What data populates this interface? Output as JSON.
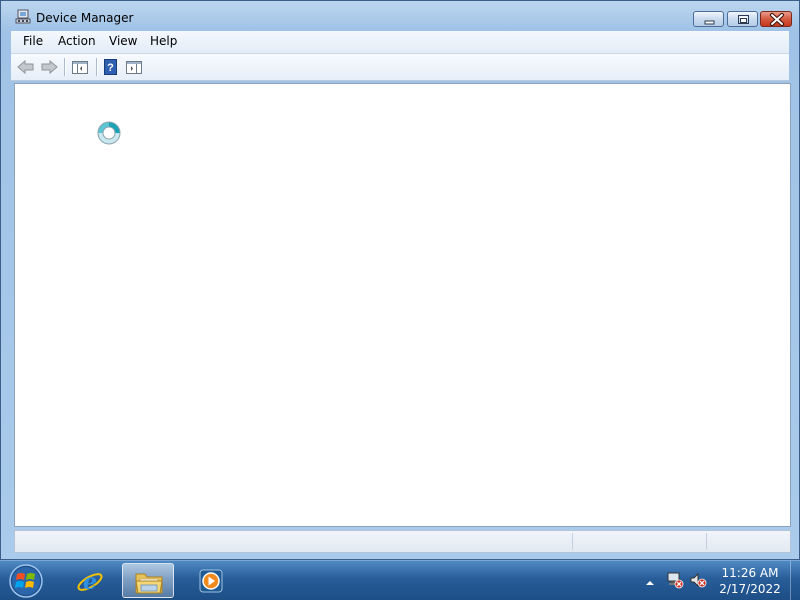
{
  "window": {
    "title": "Device Manager",
    "title_icon": "device-manager-icon"
  },
  "menubar": {
    "items": [
      "File",
      "Action",
      "View",
      "Help"
    ]
  },
  "toolbar": {
    "buttons": [
      "back-arrow-icon",
      "forward-arrow-icon",
      "show-hide-console-tree-icon",
      "help-icon",
      "show-hide-action-pane-icon"
    ]
  },
  "content": {
    "state": "loading",
    "cursor": "busy-cursor-icon"
  },
  "taskbar": {
    "pinned": [
      "internet-explorer-icon",
      "windows-explorer-icon",
      "media-player-icon"
    ],
    "active": "windows-explorer-icon",
    "tray_icons": [
      "show-hidden-icons-arrow",
      "network-icon",
      "volume-muted-icon"
    ],
    "clock": {
      "time": "11:26 AM",
      "date": "2/17/2022"
    }
  },
  "colors": {
    "taskbar": "#285d99",
    "window_frame": "#aacbeb",
    "close_button": "#d45a41"
  }
}
